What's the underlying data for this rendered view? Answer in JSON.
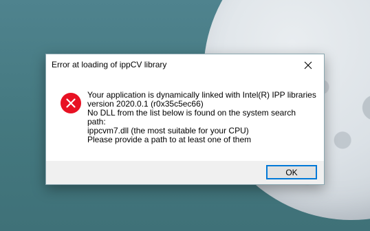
{
  "dialog": {
    "title": "Error at loading of ippCV library",
    "icon": "error-icon",
    "close_icon": "close-icon",
    "message_lines": [
      "Your application is dynamically linked with Intel(R) IPP libraries",
      "version 2020.0.1 (r0x35c5ec66)",
      "No DLL from the list below is found on the system search",
      "path:",
      "ippcvm7.dll (the most suitable for your CPU)",
      "Please provide a path to at least one of them"
    ],
    "ok_label": "OK"
  },
  "colors": {
    "error_red": "#e81123",
    "accent": "#0078d7",
    "footer_bg": "#f0f0f0"
  }
}
